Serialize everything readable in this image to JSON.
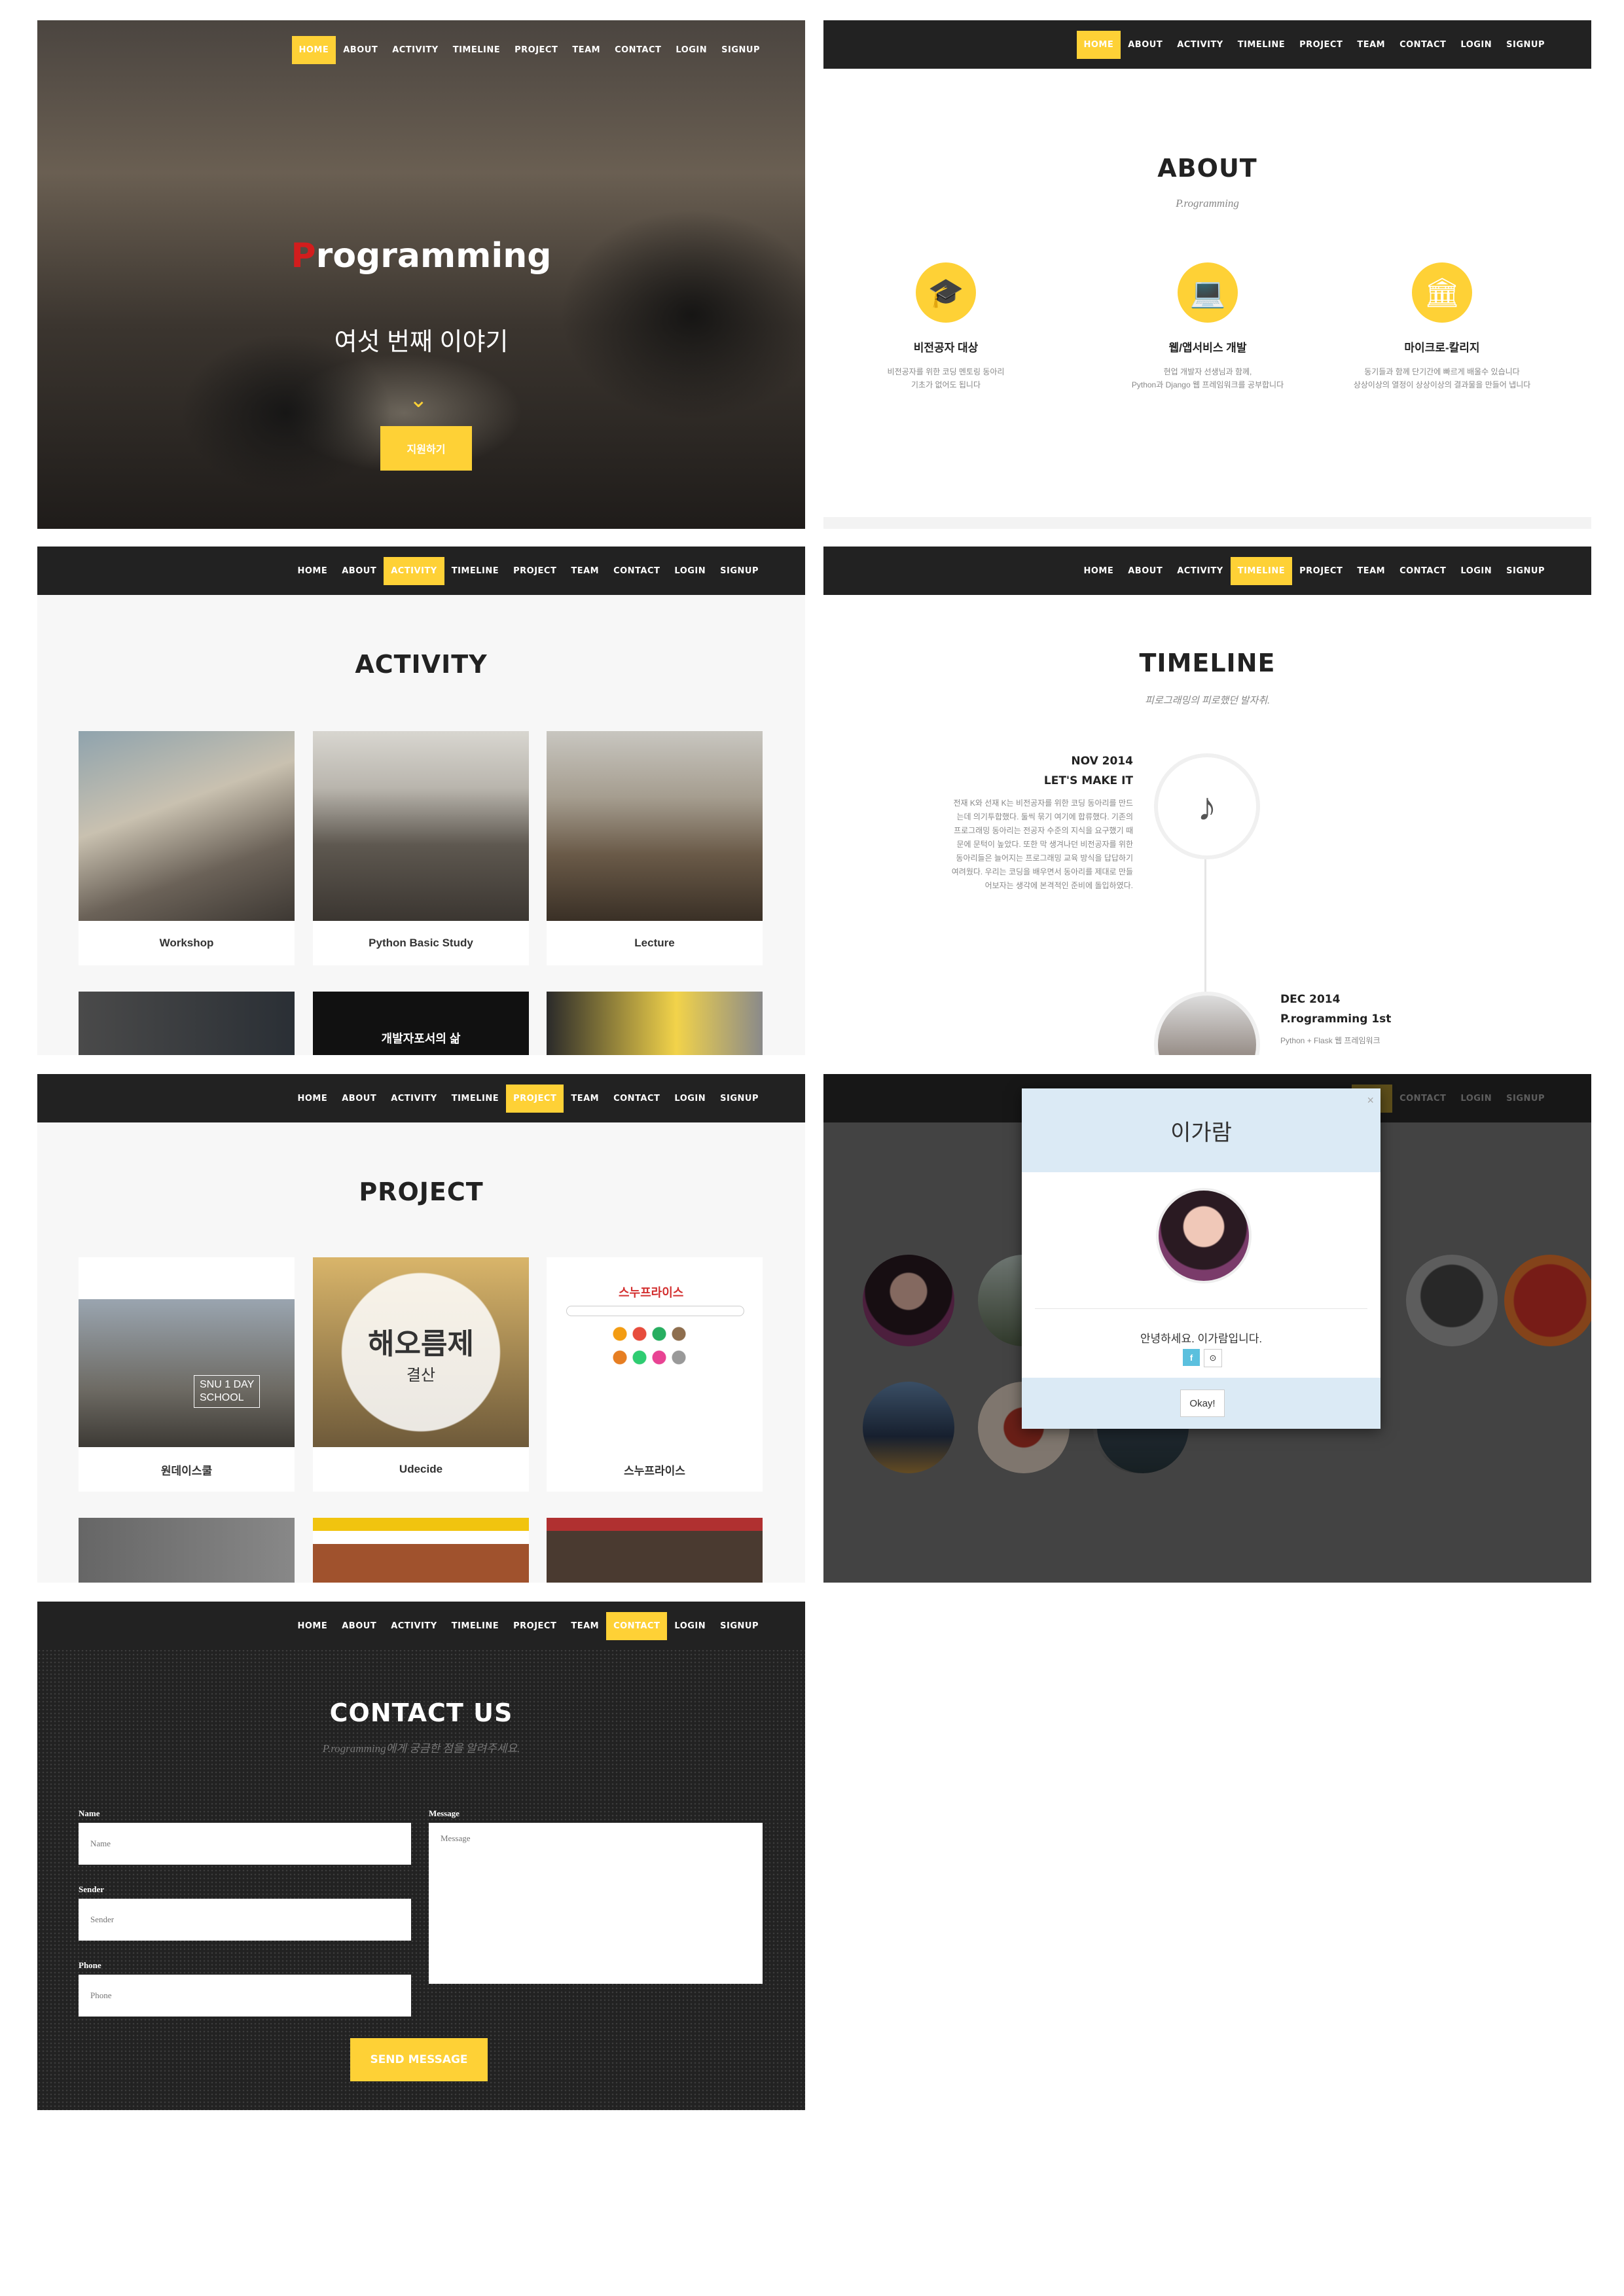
{
  "nav": [
    "HOME",
    "ABOUT",
    "ACTIVITY",
    "TIMELINE",
    "PROJECT",
    "TEAM",
    "CONTACT",
    "LOGIN",
    "SIGNUP"
  ],
  "hero": {
    "title_p": "P",
    "title_rest": "rogramming",
    "subtitle": "여섯 번째 이야기",
    "cta": "지원하기"
  },
  "about": {
    "title": "ABOUT",
    "subtitle": "P.rogramming",
    "cols": [
      {
        "icon": "graduation-cap-icon",
        "glyph": "🎓",
        "head": "비전공자 대상",
        "text1": "비전공자를 위한 코딩 멘토링 동아리",
        "text2": "기초가 없어도 됩니다"
      },
      {
        "icon": "laptop-icon",
        "glyph": "💻",
        "head": "웹/앱서비스 개발",
        "text1": "현업 개발자 선생님과 함께,",
        "text2": "Python과 Django 웹 프레임워크를 공부합니다"
      },
      {
        "icon": "institution-icon",
        "glyph": "🏛",
        "head": "마이크로-칼리지",
        "text1": "동기들과 함께 단기간에 빠르게 배울수 있습니다",
        "text2": "상상이상의 열정이 상상이상의 결과물을 만들어 냅니다"
      }
    ]
  },
  "activity": {
    "title": "ACTIVITY",
    "cards": [
      "Workshop",
      "Python Basic Study",
      "Lecture"
    ],
    "second_row_text": "개발자포서의 삶"
  },
  "timeline": {
    "title": "TIMELINE",
    "subtitle": "피로그래밍의 피로했던 발자취.",
    "e1_date": "NOV 2014",
    "e1_title": "LET'S MAKE IT",
    "e1_lines": [
      "전재 K와 선재 K는 비전공자를 위한 코딩 동아리를 만드",
      "는데 의기투합했다. 둘씩 묶기 여기에 합류했다. 기존의",
      "프로그래밍 동아리는 전공자 수준의 지식을 요구했기 때",
      "문에 문턱이 높았다. 또한 막 생겨나던 비전공자를 위한",
      "동아리들은 늘어지는 프로그래밍 교육 방식을 답답하기",
      "여려웠다. 우리는 코딩을 배우면서 동아리를 제대로 만들",
      "어보자는 생각에 본격적인 준비에 돌입하였다."
    ],
    "e2_date": "DEC 2014",
    "e2_title": "P.rogramming 1st",
    "e2_text": "Python + Flask 웹 프레임워크"
  },
  "project": {
    "title": "PROJECT",
    "cards": [
      "원데이스쿨",
      "Udecide",
      "스누프라이스"
    ],
    "snu_text1": "SNU 1 DAY",
    "snu_text2": "SCHOOL",
    "heoreum": "해오름제",
    "heoreum_sub": "결산",
    "snuprice": "스누프라이스"
  },
  "team": {
    "modal_name": "이가람",
    "greeting": "안녕하세요. 이가람입니다.",
    "fb": "f",
    "gh": "⊙",
    "ok": "Okay!",
    "close": "×",
    "nav_visible": [
      "CONTACT",
      "LOGIN",
      "SIGNUP"
    ]
  },
  "contact": {
    "title": "CONTACT US",
    "subtitle": "P.rogramming에게 궁금한 점을 알려주세요.",
    "name_label": "Name",
    "name_ph": "Name",
    "sender_label": "Sender",
    "sender_ph": "Sender",
    "phone_label": "Phone",
    "phone_ph": "Phone",
    "message_label": "Message",
    "message_ph": "Message",
    "send": "SEND MESSAGE"
  },
  "colors": {
    "accent": "#fed136",
    "nav": "#222222",
    "hero_red": "#d21d1d",
    "modal": "#dbeaf5"
  }
}
